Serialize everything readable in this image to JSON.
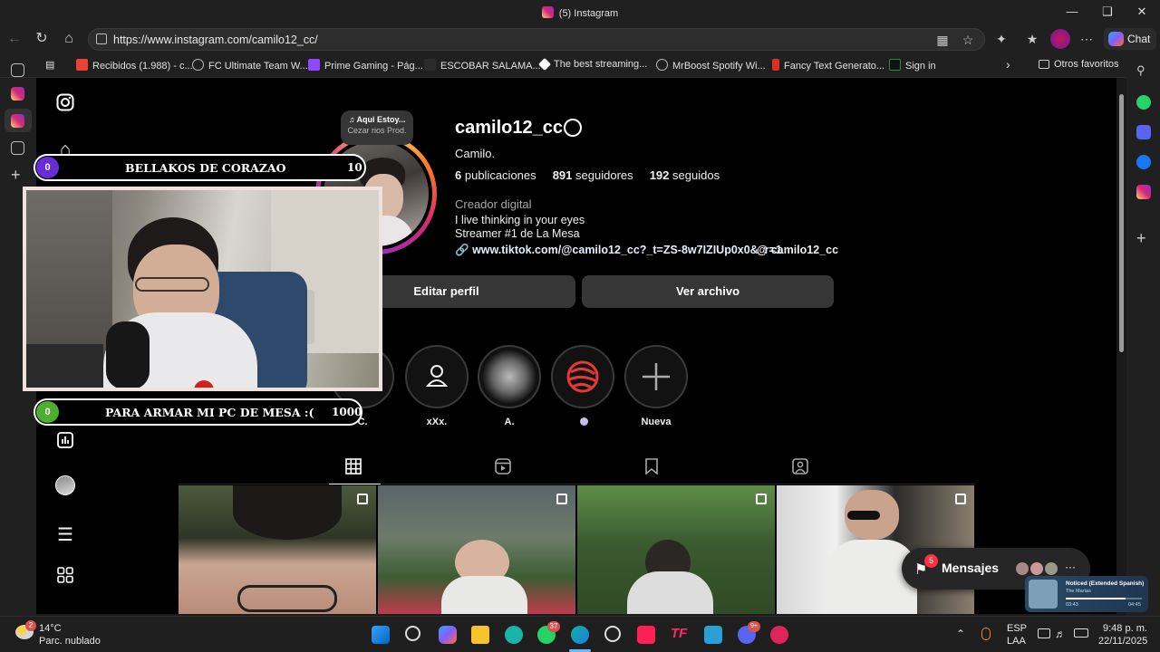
{
  "window": {
    "title": "(5) Instagram"
  },
  "browser": {
    "url": "https://www.instagram.com/camilo12_cc/",
    "chat_label": "Chat",
    "bookmarks": [
      {
        "label": "Recibidos (1.988) - c...",
        "color": "#ea4335"
      },
      {
        "label": "FC Ultimate Team W...",
        "color": "#9aa0a6"
      },
      {
        "label": "Prime Gaming - Pág...",
        "color": "#9146ff"
      },
      {
        "label": "ESCOBAR SALAMA...",
        "color": "#202020"
      },
      {
        "label": "The best streaming...",
        "color": "#ffffff"
      },
      {
        "label": "MrBoost Spotify Wi...",
        "color": "#9aa0a6"
      },
      {
        "label": "Fancy Text Generato...",
        "color": "#d93025"
      },
      {
        "label": "Sign in",
        "color": "#1e8e3e"
      }
    ],
    "bookmarks_folder": "Otros favoritos"
  },
  "overlay": {
    "goal_top": {
      "count": "0",
      "text": "BELLAKOS DE CORAZAO",
      "target": "10"
    },
    "goal_bottom": {
      "count": "0",
      "text": "PARA ARMAR MI PC DE MESA :(",
      "target": "1000"
    }
  },
  "profile": {
    "note_title": "Aqui Estoy...",
    "note_sub": "Cezar rios Prod.",
    "username": "camilo12_cc",
    "full_name": "Camilo.",
    "posts_count": "6",
    "posts_label": "publicaciones",
    "followers_count": "891",
    "followers_label": "seguidores",
    "following_count": "192",
    "following_label": "seguidos",
    "category": "Creador digital",
    "bio_line1": "I live thinking in your eyes",
    "bio_line2": "Streamer #1 de La Mesa",
    "link": "www.tiktok.com/@camilo12_cc?_t=ZS-8w7IZIUp0x0&_r=1",
    "threads_handle": "camilo12_cc",
    "edit_button": "Editar perfil",
    "archive_button": "Ver archivo"
  },
  "highlights": [
    {
      "label": "C."
    },
    {
      "label": "xXx."
    },
    {
      "label": "A."
    },
    {
      "label": ""
    },
    {
      "label": "Nueva"
    }
  ],
  "messages": {
    "label": "Mensajes",
    "badge": "5",
    "more": "···"
  },
  "media": {
    "title": "Noticed (Extended Spanish)",
    "artist": "The Marías",
    "elapsed": "03:43",
    "total": "04:45"
  },
  "taskbar": {
    "weather_temp": "14°C",
    "weather_desc": "Parc. nublado",
    "weather_badge": "2",
    "whatsapp_badge": "37",
    "discord_badge": "9+",
    "lang1": "ESP",
    "lang2": "LAA",
    "time": "9:48 p. m.",
    "date": "22/11/2025"
  }
}
